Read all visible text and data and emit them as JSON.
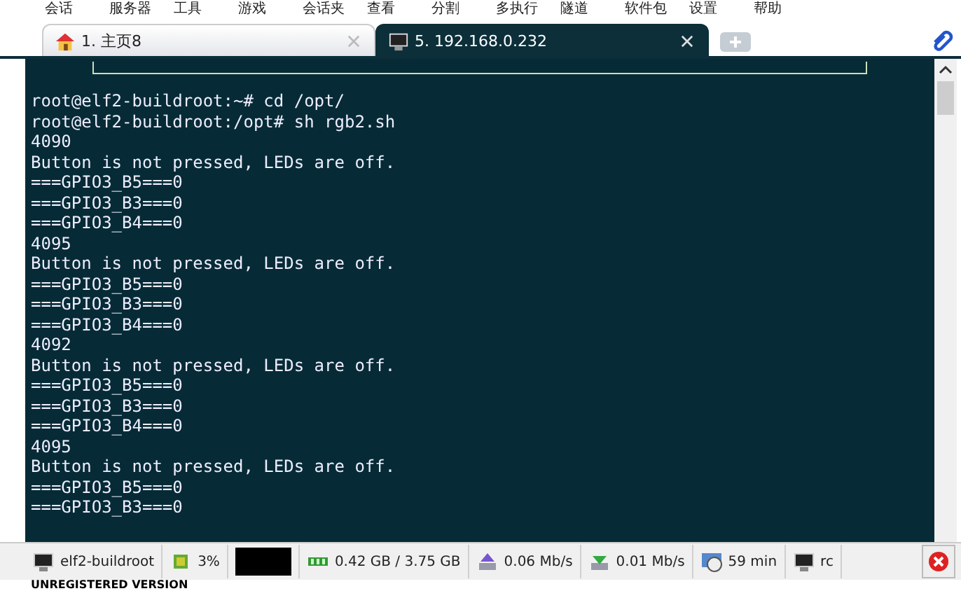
{
  "menu": [
    "会话",
    "服务器",
    "工具",
    "游戏",
    "会话夹",
    "查看",
    "分割",
    "多执行",
    "隧道",
    "软件包",
    "设置",
    "帮助"
  ],
  "tabs": [
    {
      "label": "1. 主页8",
      "kind": "home",
      "selected": false
    },
    {
      "label": "5. 192.168.0.232",
      "kind": "terminal",
      "selected": true
    }
  ],
  "terminal": {
    "lines": [
      "root@elf2-buildroot:~# cd /opt/",
      "root@elf2-buildroot:/opt# sh rgb2.sh",
      "4090",
      "Button is not pressed, LEDs are off.",
      "===GPIO3_B5===0",
      "===GPIO3_B3===0",
      "===GPIO3_B4===0",
      "4095",
      "Button is not pressed, LEDs are off.",
      "===GPIO3_B5===0",
      "===GPIO3_B3===0",
      "===GPIO3_B4===0",
      "4092",
      "Button is not pressed, LEDs are off.",
      "===GPIO3_B5===0",
      "===GPIO3_B3===0",
      "===GPIO3_B4===0",
      "4095",
      "Button is not pressed, LEDs are off.",
      "===GPIO3_B5===0",
      "===GPIO3_B3===0"
    ]
  },
  "status_bar": [
    {
      "kind": "host",
      "text": "elf2-buildroot"
    },
    {
      "kind": "cpu",
      "text": "3%"
    },
    {
      "kind": "graph"
    },
    {
      "kind": "memory",
      "text": "0.42 GB / 3.75 GB"
    },
    {
      "kind": "upload",
      "text": "0.06 Mb/s"
    },
    {
      "kind": "download",
      "text": "0.01 Mb/s"
    },
    {
      "kind": "uptime",
      "text": "59 min"
    },
    {
      "kind": "user",
      "text": "rc"
    }
  ],
  "footer": "UNREGISTERED VERSION"
}
